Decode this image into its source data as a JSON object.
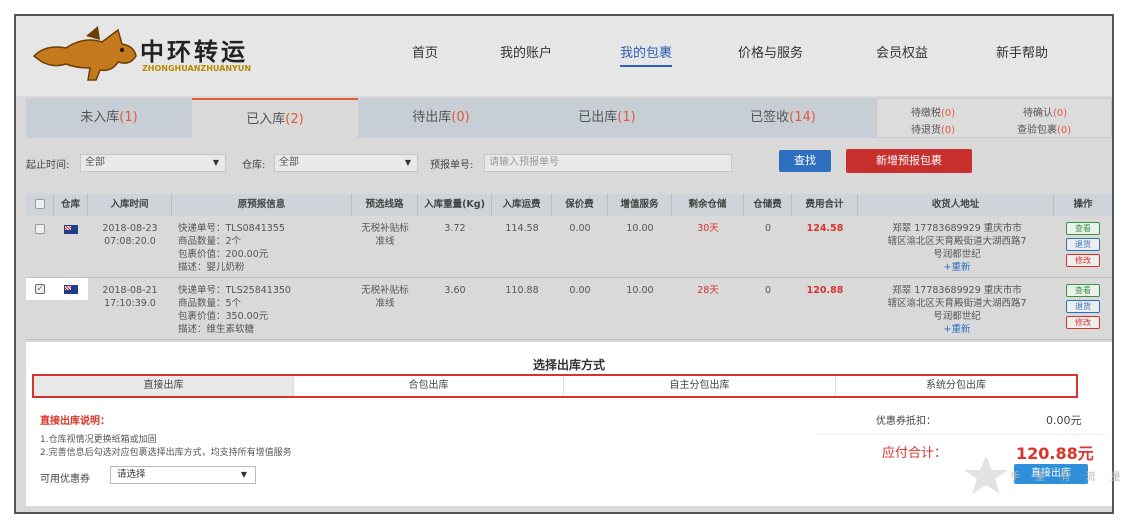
{
  "logo": {
    "title": "中环转运",
    "subtitle": "ZHONGHUANZHUANYUN"
  },
  "nav": [
    "首页",
    "我的账户",
    "我的包裹",
    "价格与服务",
    "会员权益",
    "新手帮助"
  ],
  "tabs": [
    {
      "label": "未入库",
      "count": "(1)"
    },
    {
      "label": "已入库",
      "count": "(2)"
    },
    {
      "label": "待出库",
      "count": "(0)"
    },
    {
      "label": "已出库",
      "count": "(1)"
    },
    {
      "label": "已签收",
      "count": "(14)"
    }
  ],
  "side_stats": {
    "tax": {
      "label": "待缴税",
      "count": "(0)"
    },
    "confirm": {
      "label": "待确认",
      "count": "(0)"
    },
    "return": {
      "label": "待退货",
      "count": "(0)"
    },
    "check": {
      "label": "查验包裹",
      "count": "(0)"
    }
  },
  "filters": {
    "time_label": "起止时间:",
    "time_value": "全部",
    "warehouse_label": "仓库:",
    "warehouse_value": "全部",
    "forecast_label": "预报单号:",
    "forecast_placeholder": "请输入预报单号",
    "search_label": "查找",
    "new_label": "新增预报包裹"
  },
  "columns": [
    "仓库",
    "入库时间",
    "原预报信息",
    "预选线路",
    "入库重量(Kg)",
    "入库运费",
    "保价费",
    "增值服务",
    "剩余仓储",
    "仓储费",
    "费用合计",
    "收货人地址",
    "操作"
  ],
  "rows": [
    {
      "checked": false,
      "time_date": "2018-08-23",
      "time_clock": "07:08:20.0",
      "info": [
        "快递单号：TLS0841355",
        "商品数量：2个",
        "包裹价值：200.00元",
        "描述：婴儿奶粉"
      ],
      "route": [
        "无税补贴标",
        "准线"
      ],
      "weight": "3.72",
      "freight": "114.58",
      "insurance": "0.00",
      "value_added": "10.00",
      "storage_left": "30天",
      "storage_fee": "0",
      "total": "124.58",
      "address": [
        "郑翠  17783689929  重庆市市",
        "辖区渝北区天育殿街道大湖西路7",
        "号润都世纪"
      ],
      "address_new": "+重新",
      "ops": [
        "查看",
        "退货",
        "修改"
      ]
    },
    {
      "checked": true,
      "time_date": "2018-08-21",
      "time_clock": "17:10:39.0",
      "info": [
        "快递单号：TLS25841350",
        "商品数量：5个",
        "包裹价值：350.00元",
        "描述：维生素软糖"
      ],
      "route": [
        "无税补贴标",
        "准线"
      ],
      "weight": "3.60",
      "freight": "110.88",
      "insurance": "0.00",
      "value_added": "10.00",
      "storage_left": "28天",
      "storage_fee": "0",
      "total": "120.88",
      "address": [
        "郑翠  17783689929  重庆市市",
        "辖区渝北区天育殿街道大湖西路7",
        "号润都世纪"
      ],
      "address_new": "+重新",
      "ops": [
        "查看",
        "退货",
        "修改"
      ]
    }
  ],
  "panel": {
    "title": "选择出库方式",
    "methods": [
      "直接出库",
      "合包出库",
      "自主分包出库",
      "系统分包出库"
    ],
    "explain_title": "直接出库说明：",
    "explain": [
      "1.仓库视情况更换纸箱或加固",
      "2.完善信息后勾选对应包裹选择出库方式，均支持所有增值服务"
    ],
    "coupon_label": "可用优惠券",
    "coupon_value": "请选择",
    "discount_label": "优惠券抵扣：",
    "discount_value": "0.00元",
    "total_label": "应付合计：",
    "total_value": "120.88元",
    "submit_label": "直接出库"
  },
  "watermark": "手 里 有 流 量"
}
